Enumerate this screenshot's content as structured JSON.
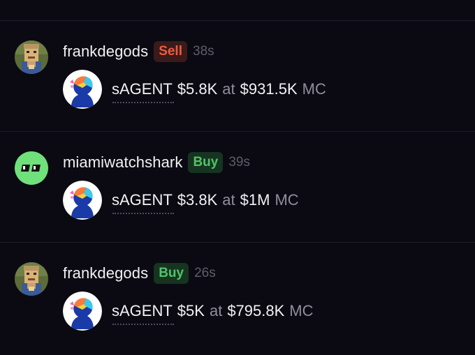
{
  "feed": {
    "trades": [
      {
        "username": "frankdegods",
        "action": "Sell",
        "age": "38s",
        "avatar": "pixel-portrait-avatar",
        "token": "sAGENT",
        "amount": "$5.8K",
        "at": "at",
        "market_cap": "$931.5K",
        "mc_label": "MC"
      },
      {
        "username": "miamiwatchshark",
        "action": "Buy",
        "age": "39s",
        "avatar": "green-eyes-avatar",
        "token": "sAGENT",
        "amount": "$3.8K",
        "at": "at",
        "market_cap": "$1M",
        "mc_label": "MC"
      },
      {
        "username": "frankdegods",
        "action": "Buy",
        "age": "26s",
        "avatar": "pixel-portrait-avatar",
        "token": "sAGENT",
        "amount": "$5K",
        "at": "at",
        "market_cap": "$795.8K",
        "mc_label": "MC"
      }
    ]
  },
  "colors": {
    "background": "#0b0a12",
    "sell": "#ee5c3d",
    "buy": "#4fc36a",
    "muted": "#8f8e9b",
    "age": "#5e5d69"
  }
}
